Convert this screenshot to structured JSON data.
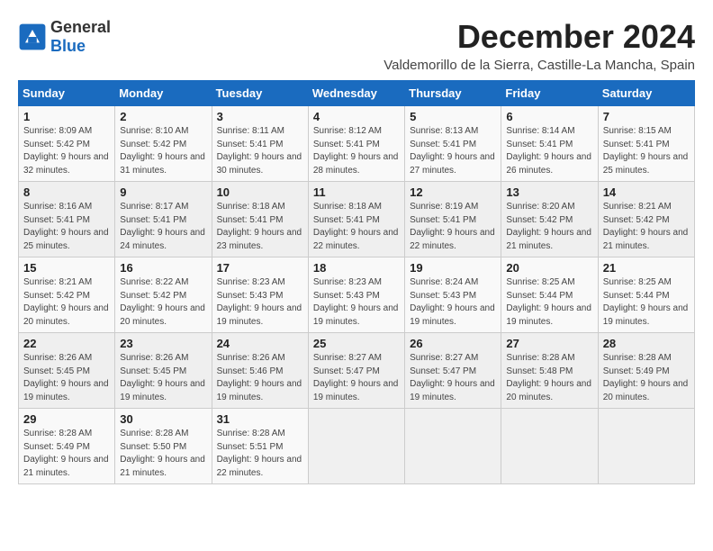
{
  "logo": {
    "general": "General",
    "blue": "Blue"
  },
  "title": "December 2024",
  "subtitle": "Valdemorillo de la Sierra, Castille-La Mancha, Spain",
  "weekdays": [
    "Sunday",
    "Monday",
    "Tuesday",
    "Wednesday",
    "Thursday",
    "Friday",
    "Saturday"
  ],
  "weeks": [
    [
      {
        "day": "1",
        "sunrise": "8:09 AM",
        "sunset": "5:42 PM",
        "daylight": "9 hours and 32 minutes."
      },
      {
        "day": "2",
        "sunrise": "8:10 AM",
        "sunset": "5:42 PM",
        "daylight": "9 hours and 31 minutes."
      },
      {
        "day": "3",
        "sunrise": "8:11 AM",
        "sunset": "5:41 PM",
        "daylight": "9 hours and 30 minutes."
      },
      {
        "day": "4",
        "sunrise": "8:12 AM",
        "sunset": "5:41 PM",
        "daylight": "9 hours and 28 minutes."
      },
      {
        "day": "5",
        "sunrise": "8:13 AM",
        "sunset": "5:41 PM",
        "daylight": "9 hours and 27 minutes."
      },
      {
        "day": "6",
        "sunrise": "8:14 AM",
        "sunset": "5:41 PM",
        "daylight": "9 hours and 26 minutes."
      },
      {
        "day": "7",
        "sunrise": "8:15 AM",
        "sunset": "5:41 PM",
        "daylight": "9 hours and 25 minutes."
      }
    ],
    [
      {
        "day": "8",
        "sunrise": "8:16 AM",
        "sunset": "5:41 PM",
        "daylight": "9 hours and 25 minutes."
      },
      {
        "day": "9",
        "sunrise": "8:17 AM",
        "sunset": "5:41 PM",
        "daylight": "9 hours and 24 minutes."
      },
      {
        "day": "10",
        "sunrise": "8:18 AM",
        "sunset": "5:41 PM",
        "daylight": "9 hours and 23 minutes."
      },
      {
        "day": "11",
        "sunrise": "8:18 AM",
        "sunset": "5:41 PM",
        "daylight": "9 hours and 22 minutes."
      },
      {
        "day": "12",
        "sunrise": "8:19 AM",
        "sunset": "5:41 PM",
        "daylight": "9 hours and 22 minutes."
      },
      {
        "day": "13",
        "sunrise": "8:20 AM",
        "sunset": "5:42 PM",
        "daylight": "9 hours and 21 minutes."
      },
      {
        "day": "14",
        "sunrise": "8:21 AM",
        "sunset": "5:42 PM",
        "daylight": "9 hours and 21 minutes."
      }
    ],
    [
      {
        "day": "15",
        "sunrise": "8:21 AM",
        "sunset": "5:42 PM",
        "daylight": "9 hours and 20 minutes."
      },
      {
        "day": "16",
        "sunrise": "8:22 AM",
        "sunset": "5:42 PM",
        "daylight": "9 hours and 20 minutes."
      },
      {
        "day": "17",
        "sunrise": "8:23 AM",
        "sunset": "5:43 PM",
        "daylight": "9 hours and 19 minutes."
      },
      {
        "day": "18",
        "sunrise": "8:23 AM",
        "sunset": "5:43 PM",
        "daylight": "9 hours and 19 minutes."
      },
      {
        "day": "19",
        "sunrise": "8:24 AM",
        "sunset": "5:43 PM",
        "daylight": "9 hours and 19 minutes."
      },
      {
        "day": "20",
        "sunrise": "8:25 AM",
        "sunset": "5:44 PM",
        "daylight": "9 hours and 19 minutes."
      },
      {
        "day": "21",
        "sunrise": "8:25 AM",
        "sunset": "5:44 PM",
        "daylight": "9 hours and 19 minutes."
      }
    ],
    [
      {
        "day": "22",
        "sunrise": "8:26 AM",
        "sunset": "5:45 PM",
        "daylight": "9 hours and 19 minutes."
      },
      {
        "day": "23",
        "sunrise": "8:26 AM",
        "sunset": "5:45 PM",
        "daylight": "9 hours and 19 minutes."
      },
      {
        "day": "24",
        "sunrise": "8:26 AM",
        "sunset": "5:46 PM",
        "daylight": "9 hours and 19 minutes."
      },
      {
        "day": "25",
        "sunrise": "8:27 AM",
        "sunset": "5:47 PM",
        "daylight": "9 hours and 19 minutes."
      },
      {
        "day": "26",
        "sunrise": "8:27 AM",
        "sunset": "5:47 PM",
        "daylight": "9 hours and 19 minutes."
      },
      {
        "day": "27",
        "sunrise": "8:28 AM",
        "sunset": "5:48 PM",
        "daylight": "9 hours and 20 minutes."
      },
      {
        "day": "28",
        "sunrise": "8:28 AM",
        "sunset": "5:49 PM",
        "daylight": "9 hours and 20 minutes."
      }
    ],
    [
      {
        "day": "29",
        "sunrise": "8:28 AM",
        "sunset": "5:49 PM",
        "daylight": "9 hours and 21 minutes."
      },
      {
        "day": "30",
        "sunrise": "8:28 AM",
        "sunset": "5:50 PM",
        "daylight": "9 hours and 21 minutes."
      },
      {
        "day": "31",
        "sunrise": "8:28 AM",
        "sunset": "5:51 PM",
        "daylight": "9 hours and 22 minutes."
      },
      null,
      null,
      null,
      null
    ]
  ],
  "sunrise_label": "Sunrise:",
  "sunset_label": "Sunset:",
  "daylight_label": "Daylight:"
}
